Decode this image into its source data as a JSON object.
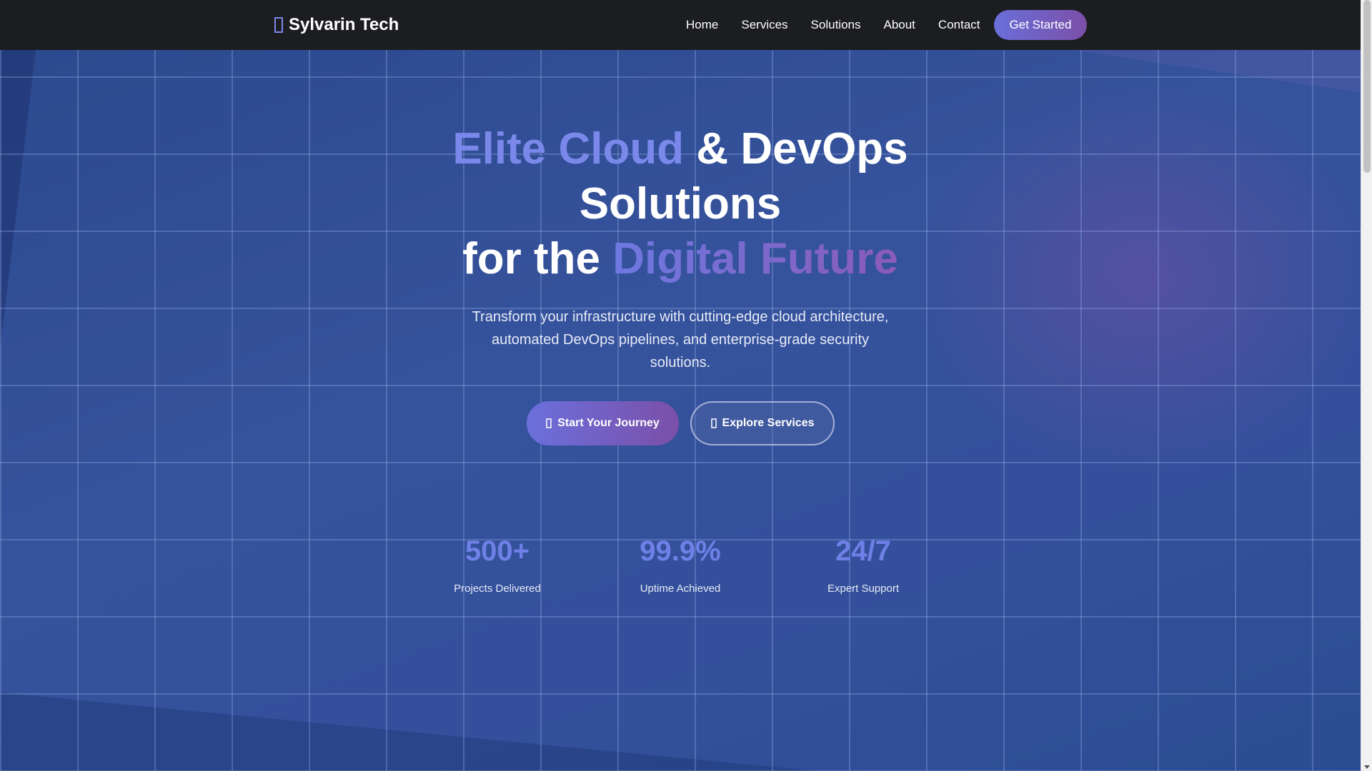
{
  "brand": {
    "name": "Sylvarin Tech",
    "icon": "brand-icon",
    "accent": "#7a88ea"
  },
  "nav": {
    "items": [
      {
        "label": "Home"
      },
      {
        "label": "Services"
      },
      {
        "label": "Solutions"
      },
      {
        "label": "About"
      },
      {
        "label": "Contact"
      }
    ],
    "cta_label": "Get Started"
  },
  "hero": {
    "headline_part1": "Elite Cloud",
    "headline_part2": " & DevOps Solutions",
    "headline_part3": "for the ",
    "headline_part4": "Digital Future",
    "subtext": "Transform your infrastructure with cutting-edge cloud architecture, automated DevOps pipelines, and enterprise-grade security solutions.",
    "primary_button": {
      "label": "Start Your Journey",
      "icon": "rocket-icon"
    },
    "secondary_button": {
      "label": "Explore Services",
      "icon": "compass-icon"
    }
  },
  "stats": [
    {
      "value": "500+",
      "label": "Projects Delivered"
    },
    {
      "value": "99.9%",
      "label": "Uptime Achieved"
    },
    {
      "value": "24/7",
      "label": "Expert Support"
    }
  ],
  "colors": {
    "navbar_bg": "#1c1d21",
    "hero_bg": "#34509c",
    "accent_blue": "#6f80e6",
    "accent_purple": "#7b4fa8"
  }
}
